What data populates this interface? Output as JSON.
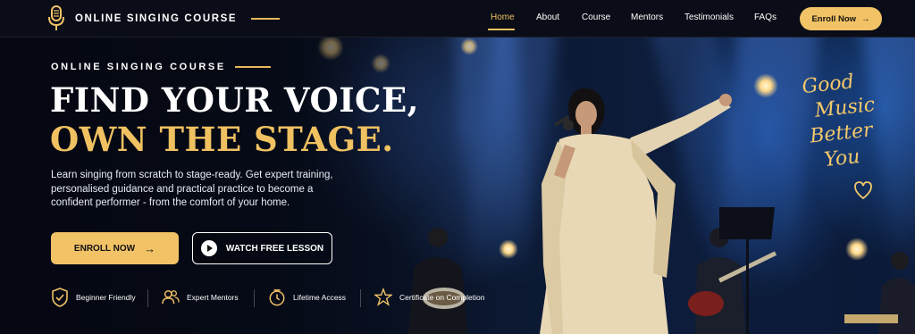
{
  "header": {
    "logo_text": "ONLINE SINGING COURSE",
    "nav": [
      {
        "label": "Home",
        "active": true
      },
      {
        "label": "About",
        "active": false
      },
      {
        "label": "Course",
        "active": false
      },
      {
        "label": "Mentors",
        "active": false
      },
      {
        "label": "Testimonials",
        "active": false
      },
      {
        "label": "FAQs",
        "active": false
      }
    ],
    "cta_label": "Enroll Now"
  },
  "hero": {
    "eyebrow": "ONLINE SINGING COURSE",
    "title_line1": "FIND YOUR VOICE,",
    "title_line2": "OWN THE STAGE.",
    "description": "Learn singing from scratch to stage-ready. Get expert training, personalised guidance and practical practice to become a confident performer - from the comfort of your home.",
    "primary_button": "ENROLL NOW",
    "secondary_button": "WATCH FREE LESSON",
    "features": [
      {
        "label": "Beginner Friendly",
        "icon": "shield-check-icon"
      },
      {
        "label": "Expert Mentors",
        "icon": "users-icon"
      },
      {
        "label": "Lifetime Access",
        "icon": "clock-icon"
      },
      {
        "label": "Certificate on Completion",
        "icon": "star-badge-icon"
      }
    ],
    "script_lines": [
      "Good",
      "Music",
      "Better",
      "You"
    ]
  },
  "colors": {
    "accent": "#f2c266",
    "background": "#0a0d17",
    "text": "#ffffff"
  }
}
